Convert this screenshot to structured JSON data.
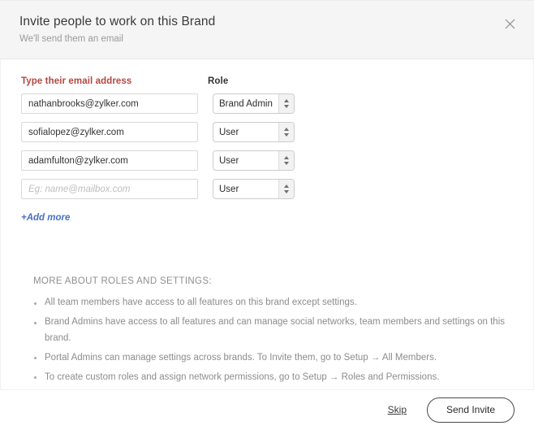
{
  "dialog": {
    "title": "Invite people to work on this Brand",
    "subtitle": "We'll send them an email",
    "close_icon": "close-icon"
  },
  "form": {
    "email_column_header": "Type their email address",
    "role_column_header": "Role",
    "rows": [
      {
        "email": "nathanbrooks@zylker.com",
        "placeholder": "Eg: name@mailbox.com",
        "role": "Brand Admin"
      },
      {
        "email": "sofialopez@zylker.com",
        "placeholder": "Eg: name@mailbox.com",
        "role": "User"
      },
      {
        "email": "adamfulton@zylker.com",
        "placeholder": "Eg: name@mailbox.com",
        "role": "User"
      },
      {
        "email": "",
        "placeholder": "Eg: name@mailbox.com",
        "role": "User"
      }
    ],
    "role_options": [
      "User",
      "Brand Admin"
    ],
    "add_more_label": "+Add more"
  },
  "info": {
    "heading": "MORE ABOUT ROLES AND SETTINGS:",
    "bullets": [
      "All team members have access to all features on this brand except settings.",
      "Brand Admins have access to all features and can manage social networks, team members and settings on this brand.",
      "Portal Admins can manage settings across brands. To Invite them, go to Setup → All Members.",
      "To create custom roles and assign network permissions, go to Setup → Roles and Permissions."
    ]
  },
  "footer": {
    "skip_label": "Skip",
    "send_invite_label": "Send Invite"
  },
  "colors": {
    "header_background": "#f5f5f5",
    "email_label": "#b5463f",
    "add_more_link": "#4a6fc4",
    "info_text": "#8c8c8c",
    "button_border": "#4a4a4a"
  }
}
